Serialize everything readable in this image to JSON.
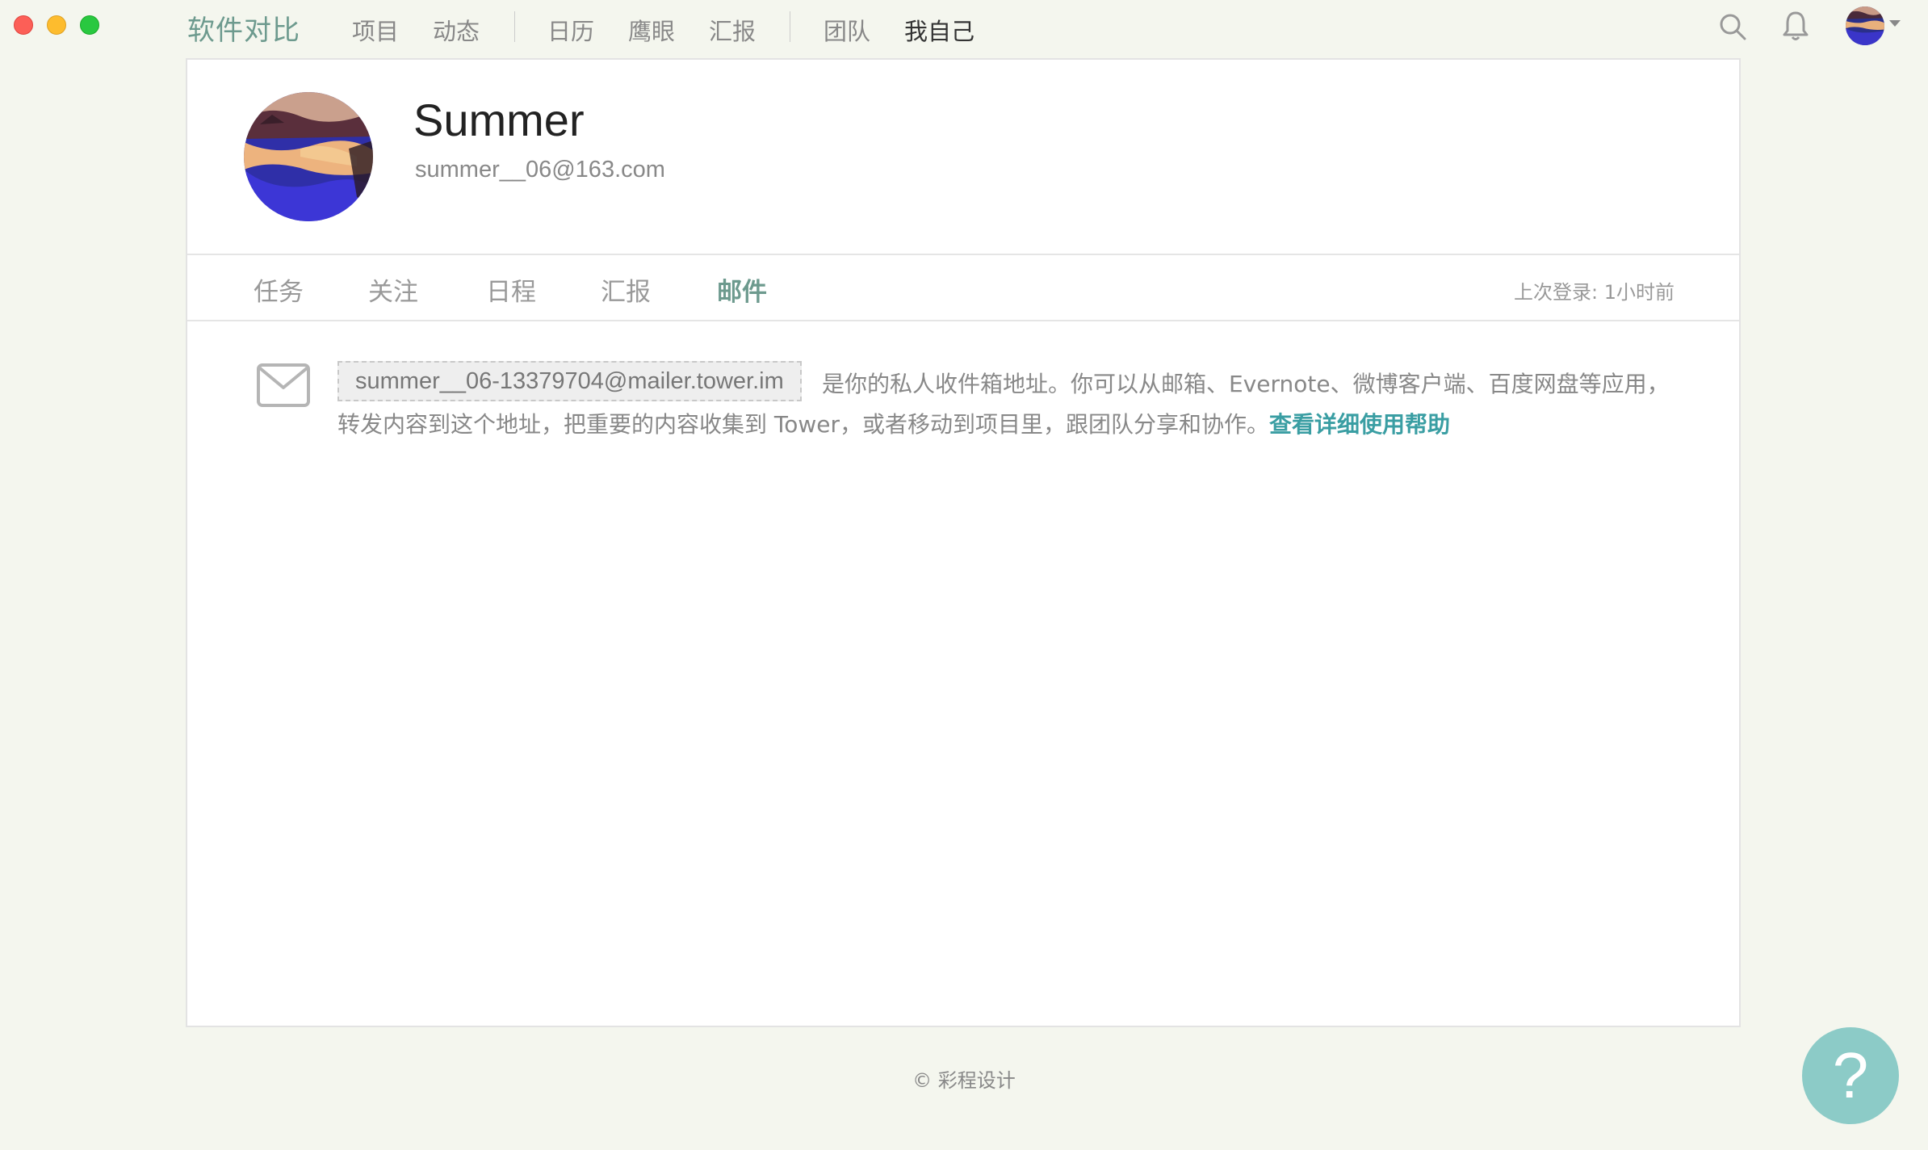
{
  "window": {
    "controls": [
      "close",
      "minimize",
      "zoom"
    ]
  },
  "nav": {
    "brand": "软件对比",
    "items": [
      "项目",
      "动态",
      "日历",
      "鹰眼",
      "汇报",
      "团队",
      "我自己"
    ],
    "active": "我自己",
    "icons": [
      "search-icon",
      "bell-icon",
      "avatar"
    ]
  },
  "profile": {
    "name": "Summer",
    "email": "summer__06@163.com"
  },
  "tabs": [
    "任务",
    "关注",
    "日程",
    "汇报",
    "邮件"
  ],
  "active_tab": "邮件",
  "last_login": "上次登录: 1小时前",
  "mail": {
    "address": "summer__06-13379704@mailer.tower.im",
    "desc_line1": "是你的私人收件箱地址。你可以从邮箱、Evernote、微博客户端、百度网盘等应用，",
    "desc_line2": "转发内容到这个地址，把重要的内容收集到 Tower，或者移动到项目里，跟团队分享和协作。",
    "help_link": "查看详细使用帮助"
  },
  "footer": "© 彩程设计",
  "help_button": "?",
  "colors": {
    "accent": "#6d9a8e",
    "link": "#3a9ea3",
    "help_bg": "#8ccbc7",
    "page_bg": "#f4f6ee"
  }
}
